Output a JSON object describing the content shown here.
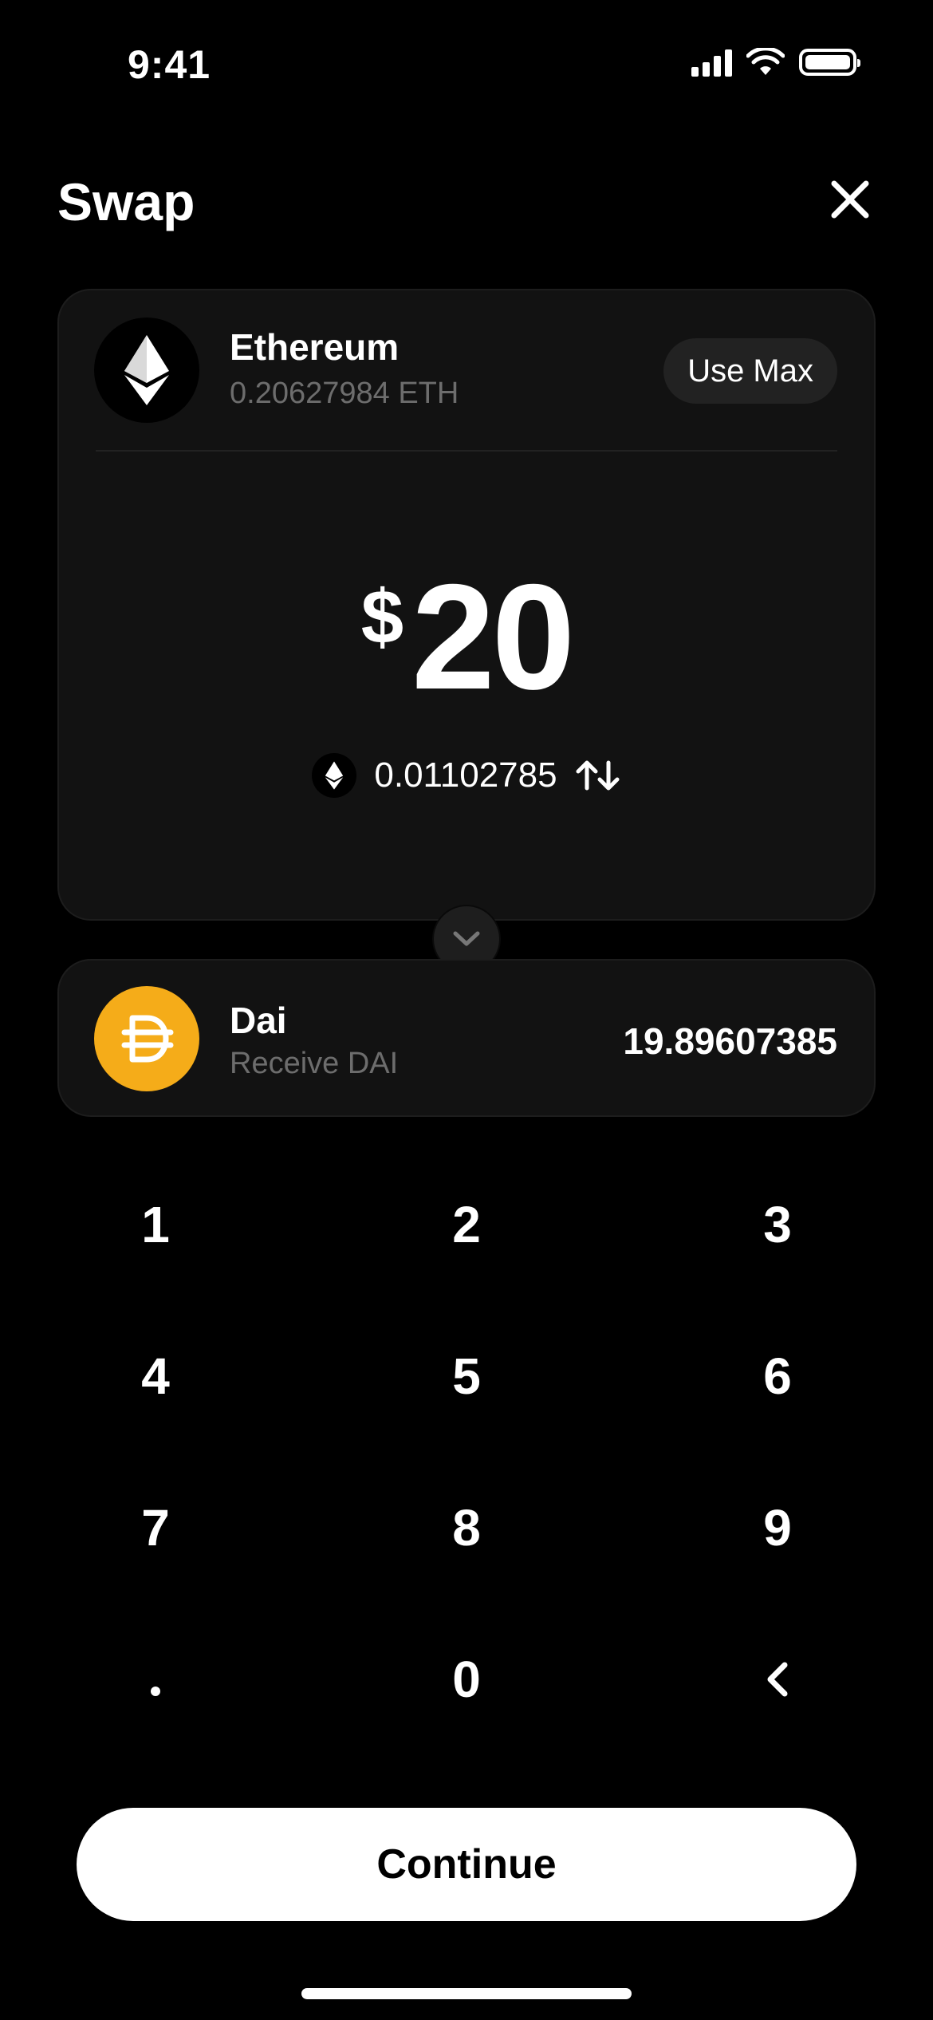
{
  "status_bar": {
    "time": "9:41"
  },
  "header": {
    "title": "Swap"
  },
  "source": {
    "token_name": "Ethereum",
    "balance": "0.20627984 ETH",
    "use_max_label": "Use Max",
    "currency_symbol": "$",
    "amount": "20",
    "token_amount": "0.01102785"
  },
  "destination": {
    "token_name": "Dai",
    "subtitle": "Receive DAI",
    "amount": "19.89607385"
  },
  "keypad": {
    "keys": [
      "1",
      "2",
      "3",
      "4",
      "5",
      "6",
      "7",
      "8",
      "9",
      ".",
      "0",
      "<"
    ]
  },
  "continue_label": "Continue",
  "colors": {
    "background": "#000000",
    "card": "#121212",
    "dai_yellow": "#F5AC19",
    "muted_text": "#6d6d6d"
  },
  "icons": {
    "close": "close-icon",
    "eth": "ethereum-icon",
    "dai": "dai-icon",
    "chevron": "chevron-down-icon",
    "swap": "swap-arrows-icon",
    "backspace": "backspace-icon"
  }
}
